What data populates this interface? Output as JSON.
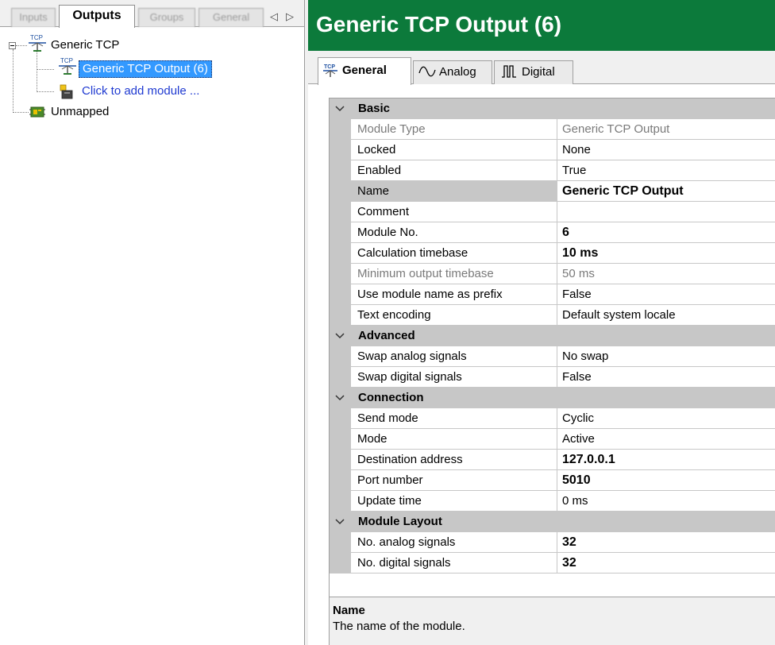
{
  "left_tabs": {
    "items": [
      {
        "label": "Inputs",
        "active": false
      },
      {
        "label": "Outputs",
        "active": true
      },
      {
        "label": "Groups",
        "active": false
      },
      {
        "label": "General",
        "active": false
      }
    ],
    "scroll_left": "◁",
    "scroll_right": "▷"
  },
  "tree": {
    "root_label": "Generic TCP",
    "selected_module": "Generic TCP Output (6)",
    "add_module": "Click to add module ...",
    "unmapped": "Unmapped"
  },
  "header": {
    "title": "Generic TCP Output (6)",
    "title_bg": "#0c7a3b"
  },
  "tabs": [
    {
      "label": "General",
      "icon": "tcp-icon",
      "active": true
    },
    {
      "label": "Analog",
      "icon": "sine-wave-icon",
      "active": false
    },
    {
      "label": "Digital",
      "icon": "pulse-icon",
      "active": false
    }
  ],
  "properties": {
    "basic": {
      "label": "Basic",
      "rows": [
        {
          "name": "Module Type",
          "value": "Generic TCP Output"
        },
        {
          "name": "Locked",
          "value": "None"
        },
        {
          "name": "Enabled",
          "value": "True"
        },
        {
          "name": "Name",
          "value": "Generic TCP Output"
        },
        {
          "name": "Comment",
          "value": ""
        },
        {
          "name": "Module No.",
          "value": "6"
        },
        {
          "name": "Calculation timebase",
          "value": "10 ms"
        },
        {
          "name": "Minimum output timebase",
          "value": "50 ms"
        },
        {
          "name": "Use module name as prefix",
          "value": "False"
        },
        {
          "name": "Text encoding",
          "value": "Default system locale"
        }
      ]
    },
    "advanced": {
      "label": "Advanced",
      "rows": [
        {
          "name": "Swap analog signals",
          "value": "No swap"
        },
        {
          "name": "Swap digital signals",
          "value": "False"
        }
      ]
    },
    "connection": {
      "label": "Connection",
      "rows": [
        {
          "name": "Send mode",
          "value": "Cyclic"
        },
        {
          "name": "Mode",
          "value": "Active"
        },
        {
          "name": "Destination address",
          "value": "127.0.0.1"
        },
        {
          "name": "Port number",
          "value": "5010"
        },
        {
          "name": "Update time",
          "value": "0 ms"
        }
      ]
    },
    "module_layout": {
      "label": "Module Layout",
      "rows": [
        {
          "name": "No. analog signals",
          "value": "32"
        },
        {
          "name": "No. digital signals",
          "value": "32"
        }
      ]
    }
  },
  "description": {
    "title": "Name",
    "text": "The name of the module."
  },
  "colors": {
    "selection": "#3399ff",
    "category_band": "#c7c7c7",
    "link": "#1f3ad1"
  }
}
